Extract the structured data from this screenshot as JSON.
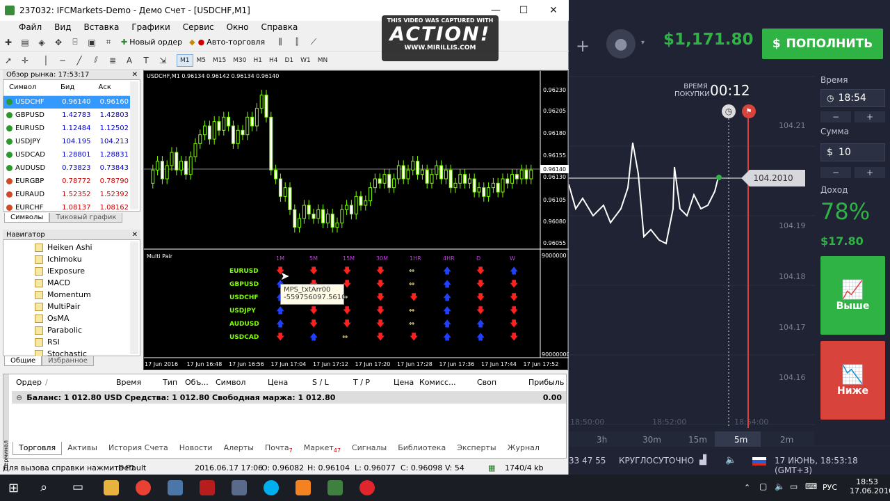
{
  "window": {
    "title": "237032: IFCMarkets-Demo - Демо Счет - [USDCHF,M1]",
    "minimize": "—",
    "maximize": "☐",
    "close": "✕"
  },
  "menu": [
    "Файл",
    "Вид",
    "Вставка",
    "Графики",
    "Сервис",
    "Окно",
    "Справка"
  ],
  "toolbar": {
    "new_order": "Новый ордер",
    "auto_trading": "Авто-торговля",
    "timeframes": [
      "M1",
      "M5",
      "M15",
      "M30",
      "H1",
      "H4",
      "D1",
      "W1",
      "MN"
    ],
    "selected_tf": "M1"
  },
  "watermark": {
    "top": "THIS VIDEO WAS CAPTURED WITH",
    "brand": "ACTION!",
    "url": "WWW.MIRILLIS.COM"
  },
  "market_watch": {
    "title": "Обзор рынка: 17:53:17",
    "headers": [
      "Символ",
      "Бид",
      "Аск"
    ],
    "rows": [
      [
        "USDCHF",
        "0.96140",
        "0.96160"
      ],
      [
        "GBPUSD",
        "1.42783",
        "1.42803"
      ],
      [
        "EURUSD",
        "1.12484",
        "1.12502"
      ],
      [
        "USDJPY",
        "104.195",
        "104.213"
      ],
      [
        "USDCAD",
        "1.28801",
        "1.28831"
      ],
      [
        "AUDUSD",
        "0.73823",
        "0.73843"
      ],
      [
        "EURGBP",
        "0.78772",
        "0.78790"
      ],
      [
        "EURAUD",
        "1.52352",
        "1.52392"
      ],
      [
        "EURCHF",
        "1.08137",
        "1.08162"
      ]
    ],
    "tabs": [
      "Символы",
      "Тиковый график"
    ]
  },
  "navigator": {
    "title": "Навигатор",
    "items": [
      "Heiken Ashi",
      "Ichimoku",
      "iExposure",
      "MACD",
      "Momentum",
      "MultiPair",
      "OsMA",
      "Parabolic",
      "RSI",
      "Stochastic"
    ],
    "tabs": [
      "Общие",
      "Избранное"
    ]
  },
  "chart": {
    "header": "USDCHF,M1  0.96134 0.96142 0.96134 0.96140",
    "price_labels": [
      "0.96230",
      "0.96205",
      "0.96180",
      "0.96155",
      "0.96140",
      "0.96130",
      "0.96105",
      "0.96080",
      "0.96055"
    ],
    "current": "0.96140",
    "sub_title": "Multi Pair",
    "sub_top": "9000000",
    "sub_bottom": "90000000",
    "time_labels": [
      "17 Jun 2016",
      "17 Jun 16:48",
      "17 Jun 16:56",
      "17 Jun 17:04",
      "17 Jun 17:12",
      "17 Jun 17:20",
      "17 Jun 17:28",
      "17 Jun 17:36",
      "17 Jun 17:44",
      "17 Jun 17:52"
    ],
    "mp_headers": [
      "1M",
      "5M",
      "15M",
      "30M",
      "1HR",
      "4HR",
      "D",
      "W"
    ],
    "mp_pairs": [
      "EURUSD",
      "GBPUSD",
      "USDCHF",
      "USDJPY",
      "AUDUSD",
      "USDCAD"
    ],
    "mp_signals": [
      [
        "d",
        "d",
        "d",
        "d",
        "n",
        "u",
        "d",
        "u"
      ],
      [
        "u",
        "d",
        "d",
        "d",
        "n",
        "u",
        "d",
        "d"
      ],
      [
        "u",
        "d",
        "n",
        "d",
        "d",
        "u",
        "d",
        "d"
      ],
      [
        "u",
        "d",
        "d",
        "d",
        "n",
        "u",
        "d",
        "d"
      ],
      [
        "u",
        "d",
        "d",
        "d",
        "n",
        "u",
        "u",
        "d"
      ],
      [
        "d",
        "u",
        "n",
        "d",
        "d",
        "u",
        "u",
        "d"
      ]
    ],
    "tooltip": {
      "name": "MPS_txtArr00",
      "value": "-559756097.5610"
    }
  },
  "terminal": {
    "headers": [
      "Ордер",
      "/",
      "Время",
      "Тип",
      "Объ...",
      "Символ",
      "Цена",
      "S / L",
      "T / P",
      "Цена",
      "Комисс...",
      "Своп",
      "Прибыль"
    ],
    "balance": "Баланс: 1 012.80 USD  Средства: 1 012.80  Свободная маржа: 1 012.80",
    "profit": "0.00",
    "tabs": [
      "Торговля",
      "Активы",
      "История Счета",
      "Новости",
      "Алерты",
      "Почта",
      "Маркет",
      "Сигналы",
      "Библиотека",
      "Эксперты",
      "Журнал"
    ],
    "mail_badge": "7",
    "market_badge": "47",
    "side_label": "Терминал"
  },
  "status": {
    "help": "Для вызова справки нажмите F1",
    "profile": "Default",
    "time": "2016.06.17 17:06",
    "open": "O: 0.96082",
    "high": "H: 0.96104",
    "low": "L: 0.96077",
    "close": "C: 0.96098",
    "volume": "V: 54",
    "traffic": "1740/4 kb"
  },
  "platform": {
    "balance": "$1,171.80",
    "deposit": "ПОПОЛНИТЬ",
    "time_label": "Время",
    "time_value": "18:54",
    "sum_label": "Сумма",
    "sum_value": "10",
    "income_label": "Доход",
    "income_pct": "78%",
    "income_val": "$17.80",
    "up": "Выше",
    "down": "Ниже",
    "buy_time_label": "ВРЕМЯ ПОКУПКИ",
    "countdown": "00:12",
    "current_price": "104.2010",
    "axis": [
      "104.21",
      "104.19",
      "104.18",
      "104.17",
      "104.16"
    ],
    "times": [
      "18:50:00",
      "18:52:00",
      "18:54:00"
    ],
    "periods": [
      "3h",
      "30m",
      "15m",
      "5m",
      "2m"
    ],
    "selected_period": "5m",
    "footer_left": "33 47 55",
    "footer_mid": "КРУГЛОСУТОЧНО",
    "footer_date": "17 ИЮНЬ, 18:53:18 (GMT+3)",
    "colors": {
      "green": "#2fb344",
      "red": "#d8433b",
      "line": "#ffffff"
    }
  },
  "taskbar": {
    "lang": "РУС",
    "time": "18:53",
    "date": "17.06.2016"
  }
}
